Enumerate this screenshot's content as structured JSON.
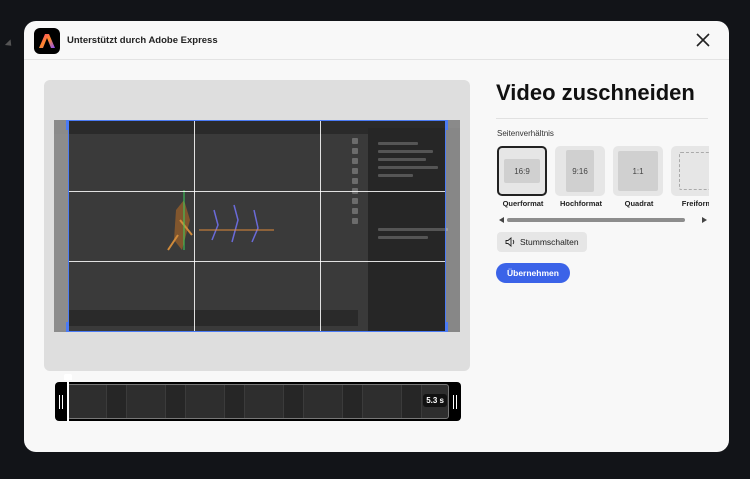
{
  "header": {
    "title": "Unterstützt durch Adobe Express",
    "logo_icon": "adobe-express-logo",
    "close_icon": "close-icon"
  },
  "preview": {
    "timeline_duration": "5.3 s"
  },
  "panel": {
    "title": "Video zuschneiden",
    "section_label": "Seitenverhältnis",
    "ratios": [
      {
        "inner": "16:9",
        "label": "Querformat",
        "selected": true
      },
      {
        "inner": "9:16",
        "label": "Hochformat",
        "selected": false
      },
      {
        "inner": "1:1",
        "label": "Quadrat",
        "selected": false
      },
      {
        "inner": "",
        "label": "Freiform",
        "selected": false
      }
    ],
    "mute_label": "Stummschalten",
    "apply_label": "Übernehmen"
  },
  "colors": {
    "accent": "#3b63e8",
    "crop_frame": "#4b7bf5"
  }
}
